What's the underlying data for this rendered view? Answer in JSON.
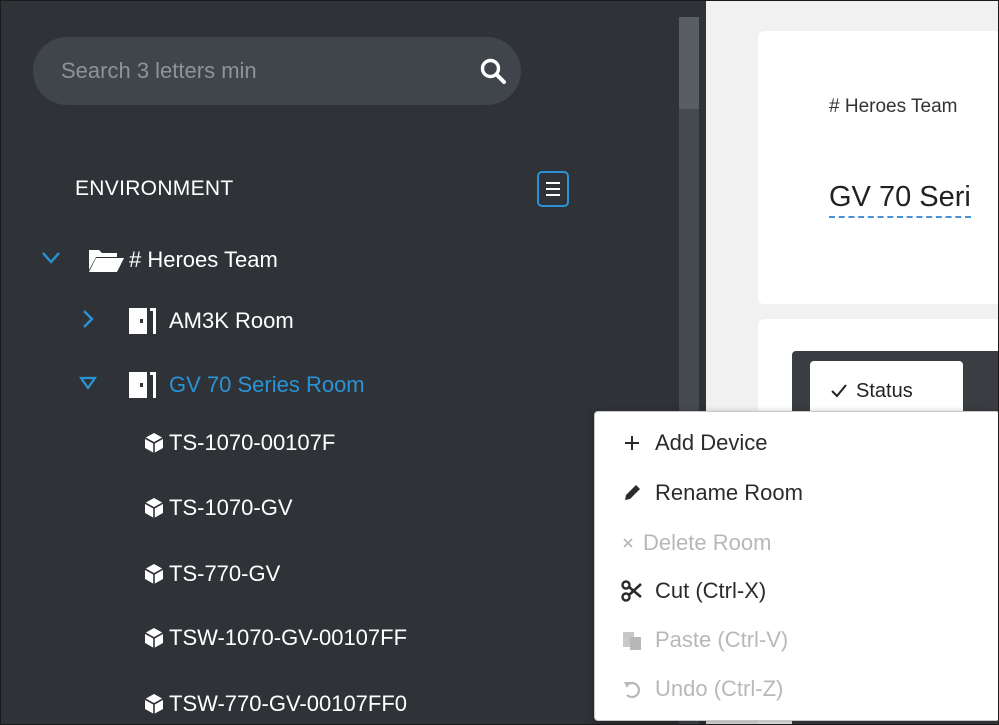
{
  "search": {
    "placeholder": "Search 3 letters min"
  },
  "environment": {
    "title": "ENVIRONMENT",
    "tree": {
      "root": {
        "label": "# Heroes Team"
      },
      "rooms": [
        {
          "label": "AM3K Room"
        },
        {
          "label": "GV 70 Series Room"
        }
      ],
      "devices": [
        {
          "label": "TS-1070-00107F"
        },
        {
          "label": "TS-1070-GV"
        },
        {
          "label": "TS-770-GV"
        },
        {
          "label": "TSW-1070-GV-00107FF"
        },
        {
          "label": "TSW-770-GV-00107FF0"
        }
      ]
    }
  },
  "main": {
    "breadcrumb": "# Heroes Team",
    "title": "GV 70 Seri",
    "status_tab": "Status"
  },
  "context_menu": {
    "items": [
      {
        "label": "Add Device",
        "icon": "plus-icon",
        "enabled": true
      },
      {
        "label": "Rename Room",
        "icon": "pencil-icon",
        "enabled": true
      },
      {
        "label": "Delete Room",
        "icon": "x-icon",
        "enabled": false
      },
      {
        "label": "Cut (Ctrl-X)",
        "icon": "scissors-icon",
        "enabled": true
      },
      {
        "label": "Paste (Ctrl-V)",
        "icon": "paste-icon",
        "enabled": false
      },
      {
        "label": "Undo (Ctrl-Z)",
        "icon": "undo-icon",
        "enabled": false
      }
    ]
  },
  "colors": {
    "sidebar_bg": "#2f3337",
    "accent": "#2a93d5",
    "disabled": "#b8b8b8"
  }
}
